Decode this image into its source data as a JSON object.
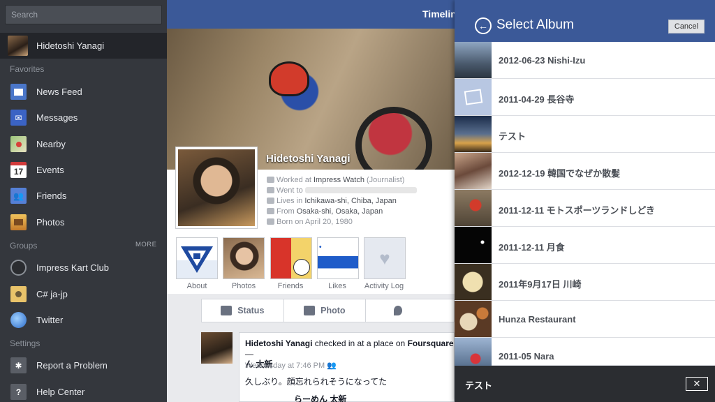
{
  "sidebar": {
    "search_placeholder": "Search",
    "user": {
      "name": "Hidetoshi Yanagi"
    },
    "favorites_header": "Favorites",
    "favorites": [
      {
        "label": "News Feed",
        "icon": "news-feed-icon"
      },
      {
        "label": "Messages",
        "icon": "messages-icon"
      },
      {
        "label": "Nearby",
        "icon": "nearby-icon"
      },
      {
        "label": "Events",
        "icon": "events-icon",
        "icon_text": "17"
      },
      {
        "label": "Friends",
        "icon": "friends-icon"
      },
      {
        "label": "Photos",
        "icon": "photos-icon"
      }
    ],
    "groups_header": "Groups",
    "groups_more": "MORE",
    "groups": [
      {
        "label": "Impress Kart Club",
        "icon": "group-icon"
      },
      {
        "label": "C# ja-jp",
        "icon": "group-icon"
      },
      {
        "label": "Twitter",
        "icon": "globe-icon"
      }
    ],
    "settings_header": "Settings",
    "settings": [
      {
        "label": "Report a Problem",
        "icon": "bug-icon"
      },
      {
        "label": "Help Center",
        "icon": "help-icon",
        "icon_text": "?"
      }
    ]
  },
  "timeline": {
    "title": "Timelin",
    "profile_name": "Hidetoshi Yanagi",
    "info": {
      "worked_prefix": "Worked at ",
      "worked_place": "Impress Watch",
      "worked_suffix": " (Journalist)",
      "went_prefix": "Went to",
      "lives_prefix": "Lives in ",
      "lives_place": "Ichikawa-shi, Chiba, Japan",
      "from_prefix": "From ",
      "from_place": "Osaka-shi, Osaka, Japan",
      "born": "Born on April 20, 1980"
    },
    "tiles": [
      "About",
      "Photos",
      "Friends",
      "Likes",
      "Activity Log"
    ],
    "actions": {
      "status": "Status",
      "photo": "Photo"
    },
    "post": {
      "author": "Hidetoshi Yanagi",
      "mid": " checked in at a place on ",
      "app": "Foursquare",
      "dash": " —",
      "place": "ん 太新",
      "time": "Wednesday at 7:46 PM",
      "text": "久しぶり。顔忘れられそうになってた",
      "attachment": "らーめん 太新"
    }
  },
  "album": {
    "title": "Select Album",
    "cancel": "Cancel",
    "items": [
      {
        "name": "2012-06-23 Nishi-Izu"
      },
      {
        "name": "2011-04-29 長谷寺"
      },
      {
        "name": "テスト"
      },
      {
        "name": "2012-12-19 韓国でなぜか散髪"
      },
      {
        "name": "2011-12-11 モトスポーツランドしどき"
      },
      {
        "name": "2011-12-11 月食"
      },
      {
        "name": "2011年9月17日 川崎"
      },
      {
        "name": "Hunza Restaurant"
      },
      {
        "name": "2011-05 Nara"
      }
    ],
    "selected": "テスト",
    "close_glyph": "✕"
  },
  "colors": {
    "brand": "#3b5998",
    "sidebar": "#34373d",
    "footer": "#2b2d31"
  }
}
